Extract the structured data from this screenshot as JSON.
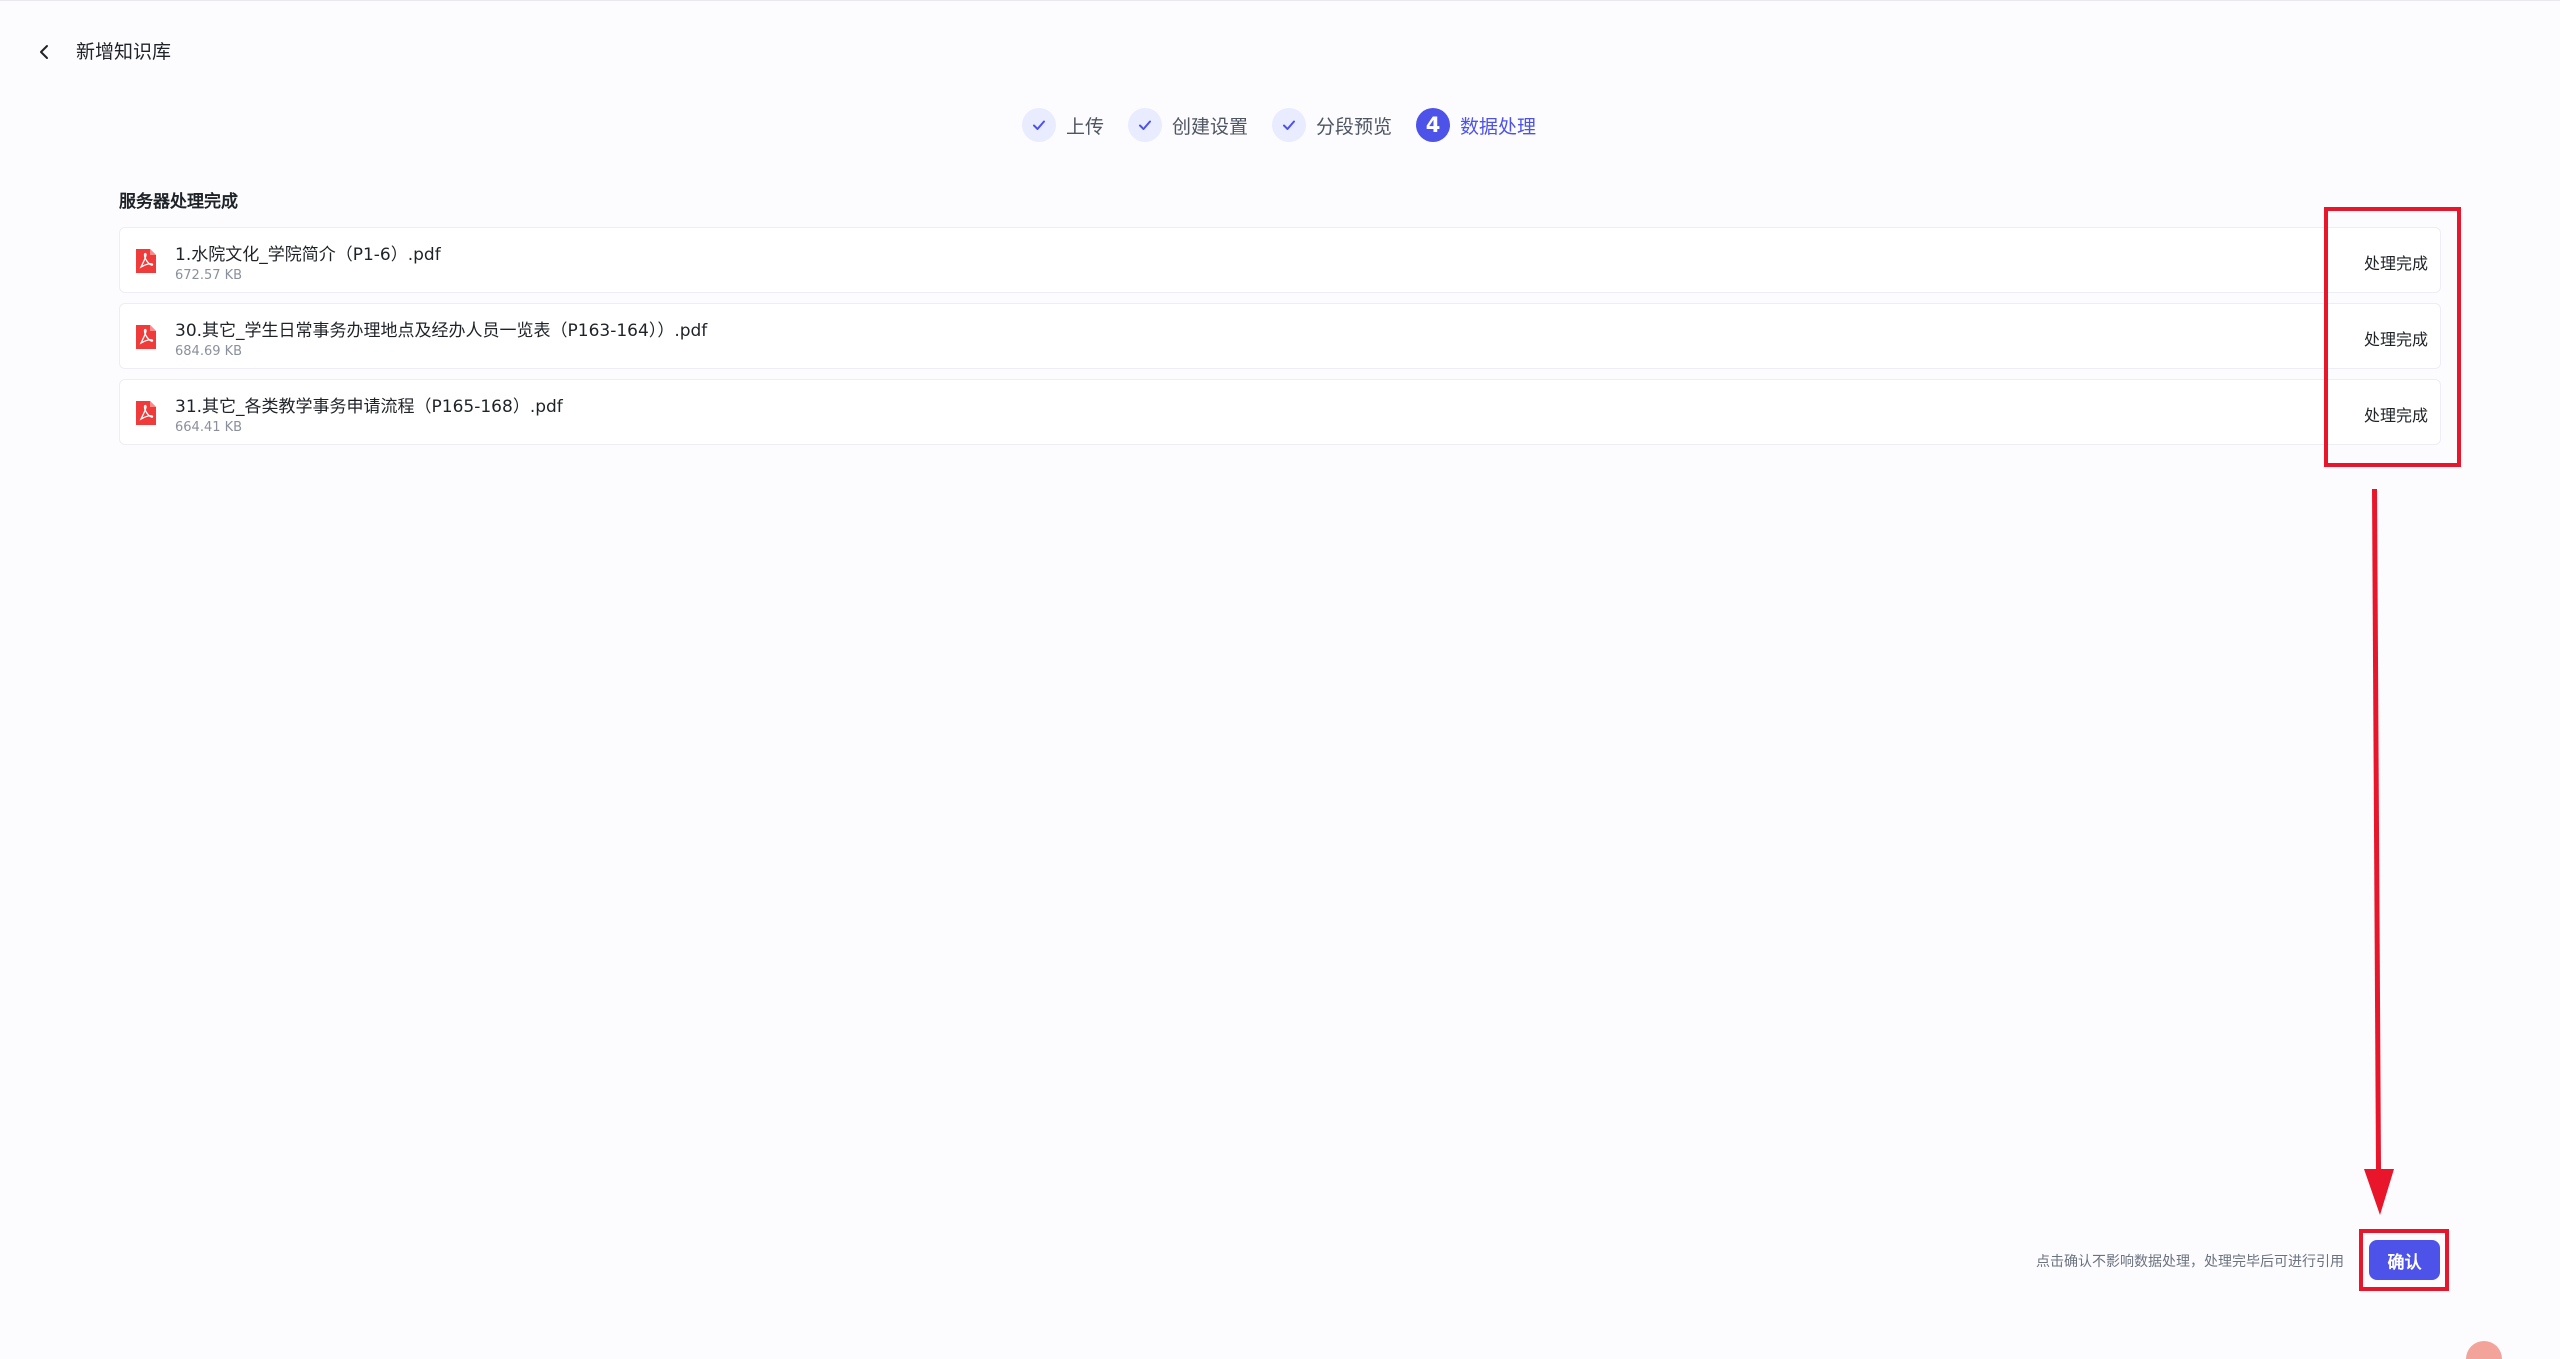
{
  "header": {
    "title": "新增知识库"
  },
  "stepper": {
    "steps": [
      {
        "label": "上传",
        "state": "done"
      },
      {
        "label": "创建设置",
        "state": "done"
      },
      {
        "label": "分段预览",
        "state": "done"
      },
      {
        "label": "数据处理",
        "state": "active",
        "number": "4"
      }
    ]
  },
  "section": {
    "title": "服务器处理完成"
  },
  "files": [
    {
      "name": "1.水院文化_学院简介（P1-6）.pdf",
      "size": "672.57 KB",
      "status": "处理完成",
      "icon": "pdf-icon"
    },
    {
      "name": "30.其它_学生日常事务办理地点及经办人员一览表（P163-164））.pdf",
      "size": "684.69 KB",
      "status": "处理完成",
      "icon": "pdf-icon"
    },
    {
      "name": "31.其它_各类教学事务申请流程（P165-168）.pdf",
      "size": "664.41 KB",
      "status": "处理完成",
      "icon": "pdf-icon"
    }
  ],
  "footer": {
    "hint": "点击确认不影响数据处理，处理完毕后可进行引用",
    "confirm_label": "确认"
  },
  "colors": {
    "accent": "#4d53e8",
    "annotation": "#e8152b",
    "pdf": "#f03b3b"
  }
}
